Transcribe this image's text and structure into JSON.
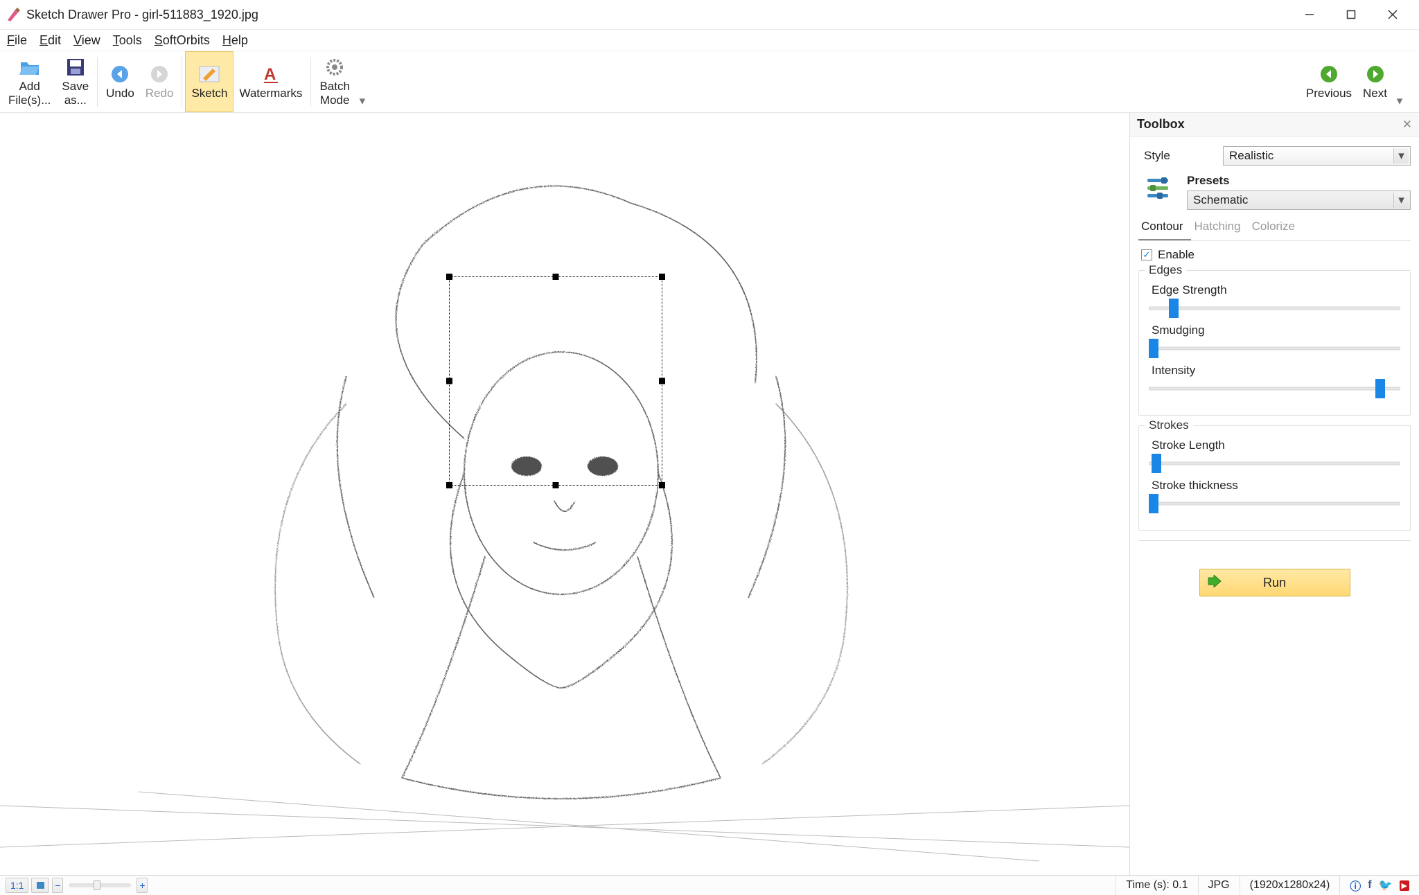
{
  "window": {
    "title": "Sketch Drawer Pro - girl-511883_1920.jpg"
  },
  "menu": {
    "file": "File",
    "edit": "Edit",
    "view": "View",
    "tools": "Tools",
    "softorbits": "SoftOrbits",
    "help": "Help"
  },
  "toolbar": {
    "addfiles": "Add\nFile(s)...",
    "saveas": "Save\nas...",
    "undo": "Undo",
    "redo": "Redo",
    "sketch": "Sketch",
    "watermarks": "Watermarks",
    "batchmode": "Batch\nMode",
    "previous": "Previous",
    "next": "Next"
  },
  "toolbox": {
    "title": "Toolbox",
    "style_label": "Style",
    "style_value": "Realistic",
    "presets_title": "Presets",
    "presets_value": "Schematic",
    "tabs": {
      "contour": "Contour",
      "hatching": "Hatching",
      "colorize": "Colorize"
    },
    "enable": "Enable",
    "edges": {
      "legend": "Edges",
      "edge_strength": "Edge Strength",
      "smudging": "Smudging",
      "intensity": "Intensity"
    },
    "strokes": {
      "legend": "Strokes",
      "stroke_length": "Stroke Length",
      "stroke_thickness": "Stroke thickness"
    },
    "run": "Run"
  },
  "status": {
    "ratio": "1:1",
    "time": "Time (s): 0.1",
    "format": "JPG",
    "dims": "(1920x1280x24)"
  },
  "sliders": {
    "edge_strength_pct": 10,
    "smudging_pct": 2,
    "intensity_pct": 92,
    "stroke_length_pct": 3,
    "stroke_thickness_pct": 2
  }
}
